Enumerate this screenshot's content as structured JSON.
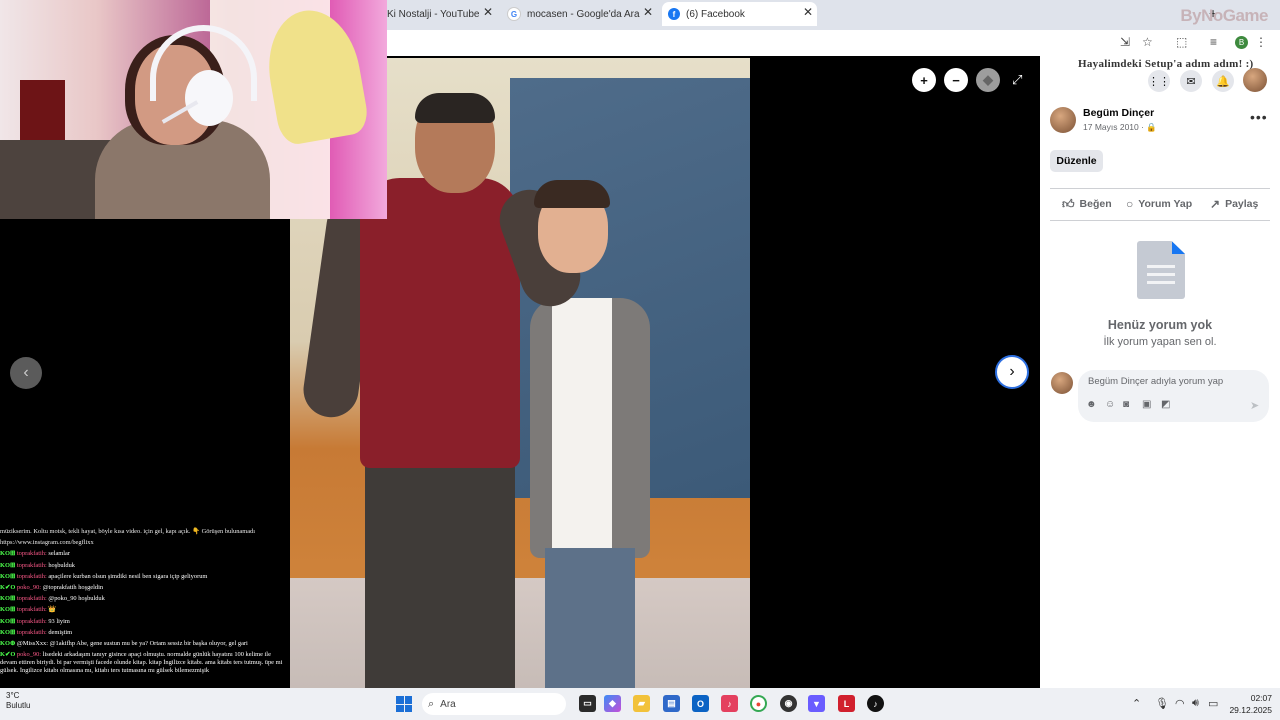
{
  "browser": {
    "tabs": [
      {
        "label": "Ki Nostalji - YouTube",
        "favicon": "youtube-icon",
        "active": false
      },
      {
        "label": "mocasen - Google'da Ara",
        "favicon": "google-icon",
        "active": false
      },
      {
        "label": "(6) Facebook",
        "favicon": "facebook-icon",
        "active": true
      }
    ],
    "new_tab": "+",
    "brand_overlay": "ByNoGame",
    "profile_initial": "B"
  },
  "viewer": {
    "zoom_in": "+",
    "zoom_out": "−",
    "prev": "‹",
    "next": "›"
  },
  "panel": {
    "overlay_caption": "Hayalimdeki Setup'a adım adım! :)",
    "poster_name": "Begüm Dinçer",
    "post_date": "17 Mayıs 2010 · 🔒",
    "edit_label": "Düzenle",
    "like_label": "Beğen",
    "comment_label": "Yorum Yap",
    "share_label": "Paylaş",
    "empty_title": "Henüz yorum yok",
    "empty_subtitle": "İlk yorum yapan sen ol.",
    "comment_placeholder": "Begüm Dinçer adıyla yorum yap"
  },
  "chat": {
    "intro": "müzikserim. Koltu motsk, tekli hayat, böyle kısa video. için gel, kapı açık. 👇 Görüşen bulunamadı https://www.instagram.com/begflixx",
    "messages": [
      {
        "user": "toprakfatih:",
        "text": "selamlar"
      },
      {
        "user": "toprakfatih:",
        "text": "hoşbulduk"
      },
      {
        "user": "toprakfatih:",
        "text": "apaçilere kurban olsun şimdiki nesil ben sigara içip geliyorum"
      },
      {
        "user": "poko_90:",
        "text": "@toprakfatih hoşgeldin"
      },
      {
        "user": "toprakfatih:",
        "text": "@poko_90 hoşbulduk"
      },
      {
        "user": "toprakfatih:",
        "text": "👑"
      },
      {
        "user": "toprakfatih:",
        "text": "93 liyim"
      },
      {
        "user": "toprakfatih:",
        "text": "demiştim"
      },
      {
        "user": "@MissXxx:",
        "text": "@1akifhp Abe, gene sustun mu be ya? Ortam sessiz bir başka oluyor, gel gari"
      },
      {
        "user": "poko_90:",
        "text": "lisedeki arkadaşım tanıyr gisince apaçi olmuştu. normalde günlük hayatını 100 kelime ile devam ettiren biriydi. bi par vermişti facede olunde kitap. kitap İngilizce kitabı. ama kitabı ters tutmuş. üpe mi gülsek. İngilizce kitabı olmasına mı, kitabı ters tutmasına mı gülsek bilemezmişik"
      }
    ]
  },
  "taskbar": {
    "weather_temp": "3°C",
    "weather_desc": "Bulutlu",
    "search_label": "Ara",
    "time": "02:07",
    "date": "29.12.2025"
  }
}
